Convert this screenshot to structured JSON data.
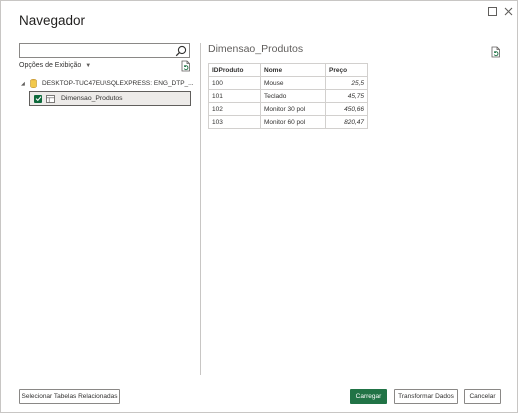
{
  "window": {
    "title": "Navegador",
    "maximize_icon": "maximize-icon",
    "close_icon": "close-icon"
  },
  "left_pane": {
    "search": {
      "value": "",
      "placeholder": ""
    },
    "view_options_label": "Opções de Exibição",
    "tree": {
      "server_label": "DESKTOP-TUC47EU\\SQLEXPRESS: ENG_DTP_...",
      "table_label": "Dimensao_Produtos",
      "table_checked": true
    }
  },
  "preview": {
    "title": "Dimensao_Produtos",
    "columns": [
      "IDProduto",
      "Nome",
      "Preço"
    ],
    "rows": [
      [
        "100",
        "Mouse",
        "25,5"
      ],
      [
        "101",
        "Teclado",
        "45,75"
      ],
      [
        "102",
        "Monitor 30 pol",
        "450,66"
      ],
      [
        "103",
        "Monitor 60 pol",
        "820,47"
      ]
    ]
  },
  "footer": {
    "related_label": "Selecionar Tabelas Relacionadas",
    "load_label": "Carregar",
    "transform_label": "Transformar Dados",
    "cancel_label": "Cancelar"
  },
  "colors": {
    "accent": "#217346",
    "checkbox": "#0e6a3c",
    "border": "#c8c6c4"
  }
}
